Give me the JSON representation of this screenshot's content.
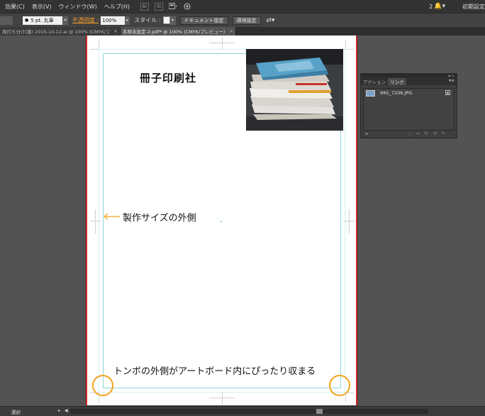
{
  "menubar": {
    "items": [
      "効果(C)",
      "表示(V)",
      "ウィンドウ(W)",
      "ヘルプ(H)"
    ],
    "bridge_icon": "Br",
    "stock_icon": "St",
    "notification_count": "2",
    "workspace": "初期設定"
  },
  "controlbar": {
    "stroke_profile": "5 pt. 丸筆",
    "opacity_label": "不透明度 :",
    "opacity_value": "100%",
    "style_label": "スタイル :",
    "document_setup": "ドキュメント設定",
    "preferences": "環境設定"
  },
  "tabs": [
    {
      "label": "扉打ち分け(案) 2015-10-12.ai @ 100% (CMYK/プレビュー)",
      "active": false
    },
    {
      "label": "名称未設定-2.pdf* @ 100% (CMYK/プレビュー)",
      "active": true
    }
  ],
  "artboard": {
    "title": "冊子印刷社",
    "label_outside": "製作サイズの外側",
    "label_trim": "トンボの外側がアートボード内にぴったり収まる"
  },
  "links_panel": {
    "tabs": [
      "アクション",
      "リンク"
    ],
    "items": [
      {
        "name": "IMG_7206.JPG"
      }
    ]
  },
  "statusbar": {
    "selection": "選択"
  },
  "colors": {
    "accent_orange": "#f3a21b",
    "guide_cyan": "#8ed6da",
    "artboard_red": "#d12a2a"
  }
}
